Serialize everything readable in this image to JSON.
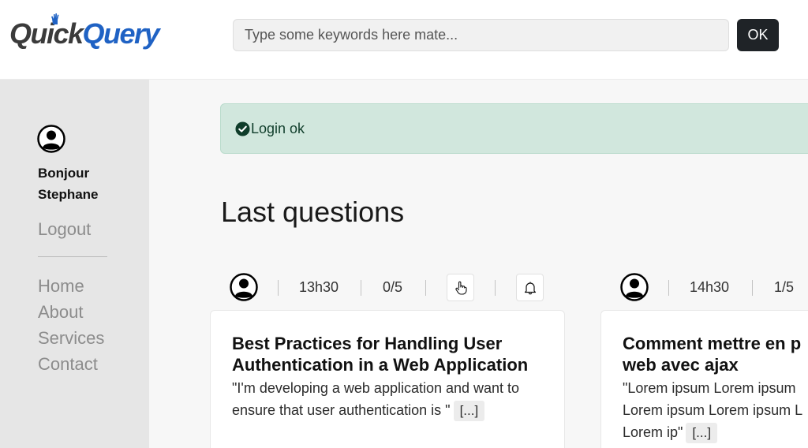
{
  "header": {
    "logo_part1": "Quick",
    "logo_part2": "Query",
    "search_placeholder": "Type some keywords here mate...",
    "ok_label": "OK"
  },
  "sidebar": {
    "greeting_line1": "Bonjour",
    "greeting_line2": "Stephane",
    "logout_label": "Logout",
    "nav": [
      "Home",
      "About",
      "Services",
      "Contact"
    ]
  },
  "alert": {
    "text": "Login ok"
  },
  "main": {
    "section_title": "Last questions",
    "questions": [
      {
        "time": "13h30",
        "score": "0/5",
        "title": "Best Practices for Handling User Authentication in a Web Application",
        "excerpt": "\"I'm developing a web application and want to ensure that user authentication is \"",
        "more": "[...]"
      },
      {
        "time": "14h30",
        "score": "1/5",
        "title": "Comment mettre en p web avec ajax",
        "excerpt": "\"Lorem ipsum Lorem ipsum Lorem ipsum Lorem ipsum L Lorem ip\"",
        "more": "[...]"
      }
    ]
  },
  "colors": {
    "brand_dark": "#3b3b3b",
    "brand_blue": "#1f62c4",
    "ok_button": "#1f2327",
    "alert_bg": "#d1e7dd",
    "sidebar_bg": "#e6e6e6"
  },
  "icons": [
    "user-circle-icon",
    "hand-pointer-icon",
    "bell-icon",
    "check-circle-icon"
  ]
}
